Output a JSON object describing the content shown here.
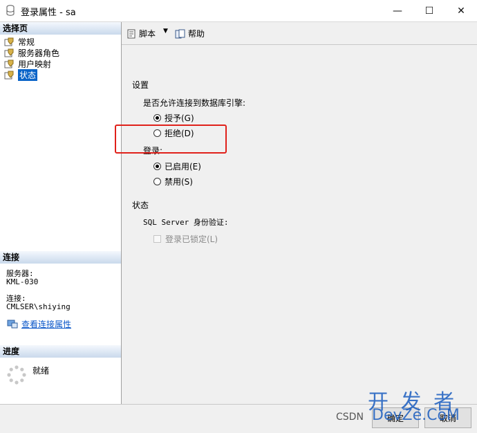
{
  "window": {
    "title": "登录属性 - sa",
    "minimize": "—",
    "maximize": "☐",
    "close": "✕"
  },
  "left": {
    "select_page_header": "选择页",
    "pages": [
      {
        "label": "常规",
        "icon": "page-icon"
      },
      {
        "label": "服务器角色",
        "icon": "page-icon"
      },
      {
        "label": "用户映射",
        "icon": "page-icon"
      },
      {
        "label": "状态",
        "icon": "page-icon",
        "selected": true
      }
    ],
    "connection_header": "连接",
    "server_label": "服务器:",
    "server_value": "KML-030",
    "connection_label": "连接:",
    "connection_value": "CMLSER\\shiying",
    "view_connection_link": "查看连接属性",
    "progress_header": "进度",
    "progress_status": "就绪"
  },
  "toolbar": {
    "script_label": "脚本",
    "help_label": "帮助"
  },
  "settings": {
    "section_title": "设置",
    "permission_question": "是否允许连接到数据库引擎:",
    "grant_label": "授予(G)",
    "deny_label": "拒绝(D)",
    "grant_selected": true,
    "login_label": "登录:",
    "enabled_label": "已启用(E)",
    "disabled_label": "禁用(S)",
    "enabled_selected": true
  },
  "status": {
    "section_title": "状态",
    "auth_label": "SQL Server 身份验证:",
    "locked_label": "登录已锁定(L)",
    "locked_checked": false
  },
  "footer": {
    "ok_label": "确定",
    "cancel_label": "取消"
  },
  "watermark": {
    "line1": "开 发 者",
    "line2": "DevZe.CoM",
    "csdn": "CSDN"
  },
  "colors": {
    "highlight": "#e0201a",
    "link": "#0b57c9",
    "selection": "#0a64c8"
  }
}
